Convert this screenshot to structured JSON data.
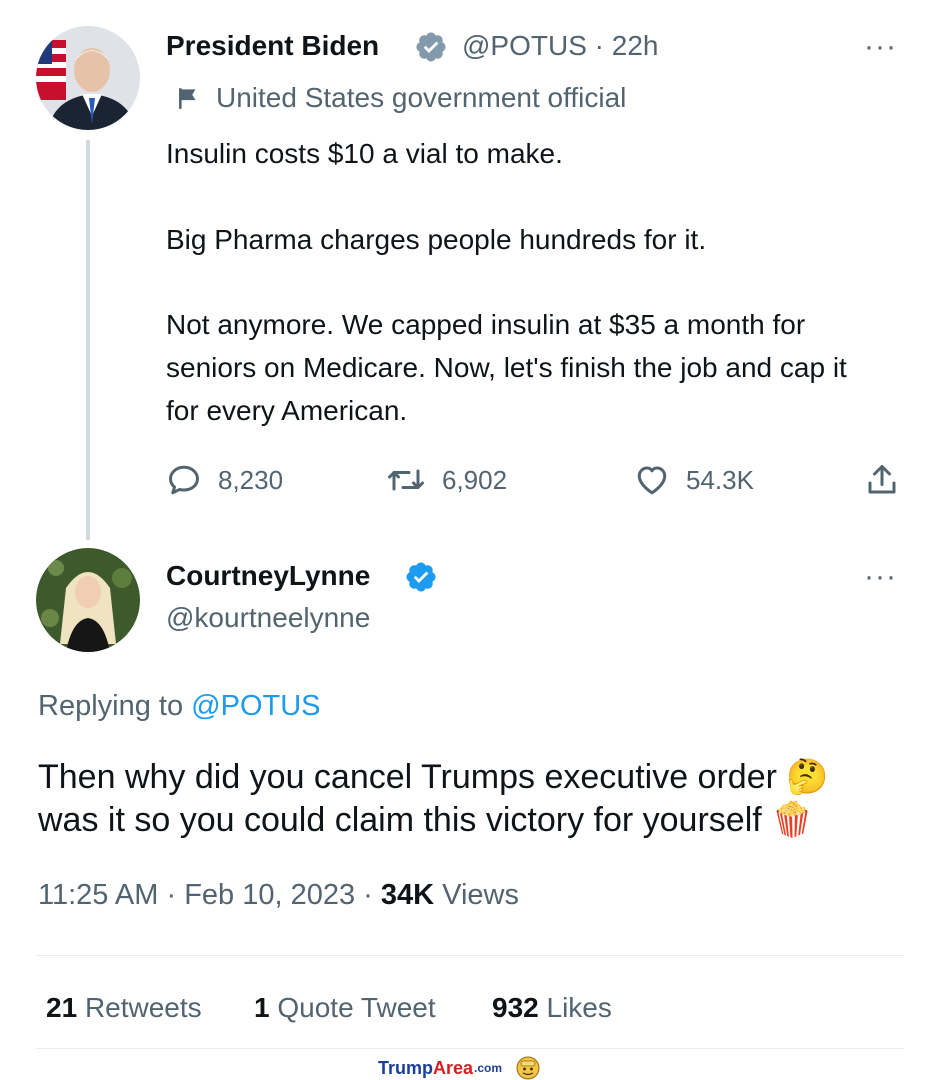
{
  "tweet1": {
    "display_name": "President Biden",
    "handle": "@POTUS",
    "separator": "·",
    "time_ago": "22h",
    "label": "United States government official",
    "paragraph1": "Insulin costs $10 a vial to make.",
    "paragraph2": "Big Pharma charges people hundreds for it.",
    "paragraph3": "Not anymore. We capped insulin at $35 a month for seniors on Medicare. Now, let's finish the job and cap it for every American.",
    "replies": "8,230",
    "retweets": "6,902",
    "likes": "54.3K",
    "more": "···"
  },
  "tweet2": {
    "display_name": "CourtneyLynne",
    "handle": "@kourtneelynne",
    "more": "···",
    "replying_prefix": "Replying to",
    "replying_handle": "@POTUS",
    "line1": "Then why did you cancel Trumps executive order",
    "emoji1": "🤔",
    "line2": "was it so you could claim this victory for yourself",
    "emoji2": "🍿",
    "time": "11:25 AM",
    "date": "Feb 10, 2023",
    "separator": "·",
    "views_count": "34K",
    "views_label": "Views",
    "retweets_count": "21",
    "retweets_label": "Retweets",
    "quotes_count": "1",
    "quotes_label": "Quote Tweet",
    "likes_count": "932",
    "likes_label": "Likes"
  },
  "watermark": {
    "part1": "Trump",
    "part2": "Area",
    "part3": ".com"
  },
  "colors": {
    "verified": "#1d9bf0",
    "muted": "#536471",
    "text": "#0f1419",
    "link": "#1d9bf0",
    "watermark_blue": "#1a3f9a",
    "watermark_red": "#d42020"
  }
}
